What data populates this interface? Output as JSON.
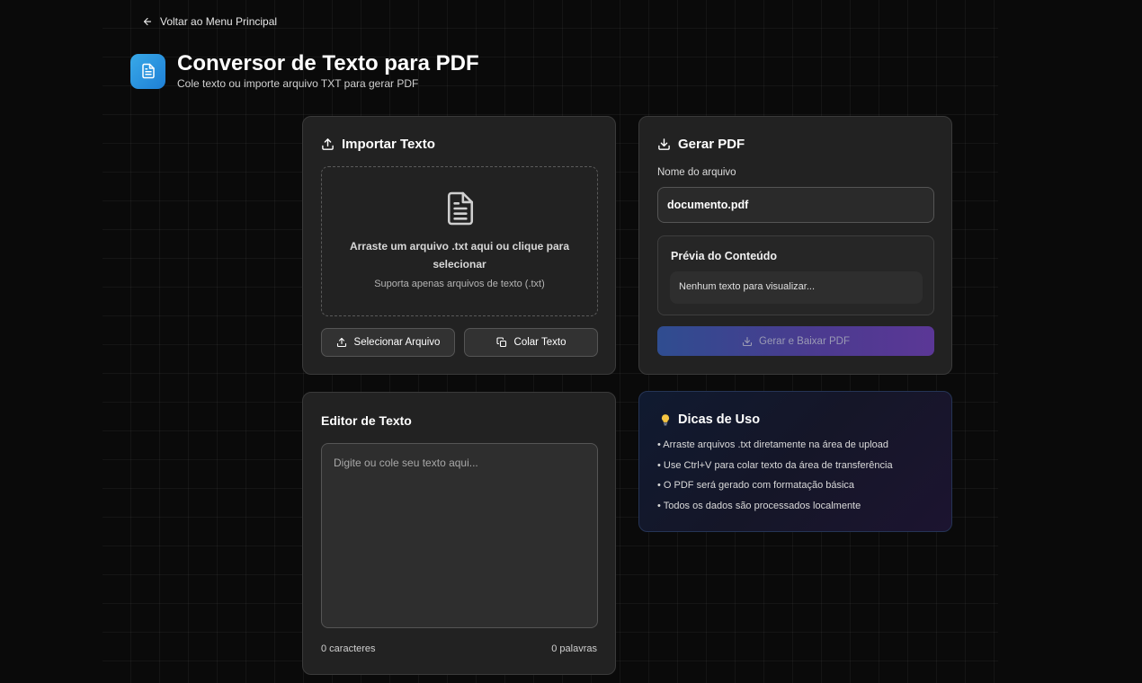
{
  "nav": {
    "back_label": "Voltar ao Menu Principal"
  },
  "header": {
    "title": "Conversor de Texto para PDF",
    "subtitle": "Cole texto ou importe arquivo TXT para gerar PDF"
  },
  "import_card": {
    "title": "Importar Texto",
    "dropzone_main": "Arraste um arquivo .txt aqui ou clique para selecionar",
    "dropzone_sub": "Suporta apenas arquivos de texto (.txt)",
    "select_button": "Selecionar Arquivo",
    "paste_button": "Colar Texto"
  },
  "generate_card": {
    "title": "Gerar PDF",
    "filename_label": "Nome do arquivo",
    "filename_value": "documento.pdf",
    "preview_title": "Prévia do Conteúdo",
    "preview_empty": "Nenhum texto para visualizar...",
    "generate_button": "Gerar e Baixar PDF"
  },
  "editor_card": {
    "title": "Editor de Texto",
    "placeholder": "Digite ou cole seu texto aqui...",
    "char_count": "0 caracteres",
    "word_count": "0 palavras"
  },
  "tips_card": {
    "title": "Dicas de Uso",
    "items": [
      "• Arraste arquivos .txt diretamente na área de upload",
      "• Use Ctrl+V para colar texto da área de transferência",
      "• O PDF será gerado com formatação básica",
      "• Todos os dados são processados localmente"
    ]
  },
  "icons": {
    "back": "arrow-left-icon",
    "app": "file-text-icon",
    "import": "upload-icon",
    "dropzone": "document-icon",
    "paste": "copy-icon",
    "generate": "download-icon",
    "tips": "lightbulb-icon"
  },
  "colors": {
    "background": "#0a0a0a",
    "card": "#222222",
    "accent_blue": "#1e7fd6",
    "gradient_start": "#2f4d90",
    "gradient_end": "#5b3796",
    "bulb": "#f5c542"
  }
}
